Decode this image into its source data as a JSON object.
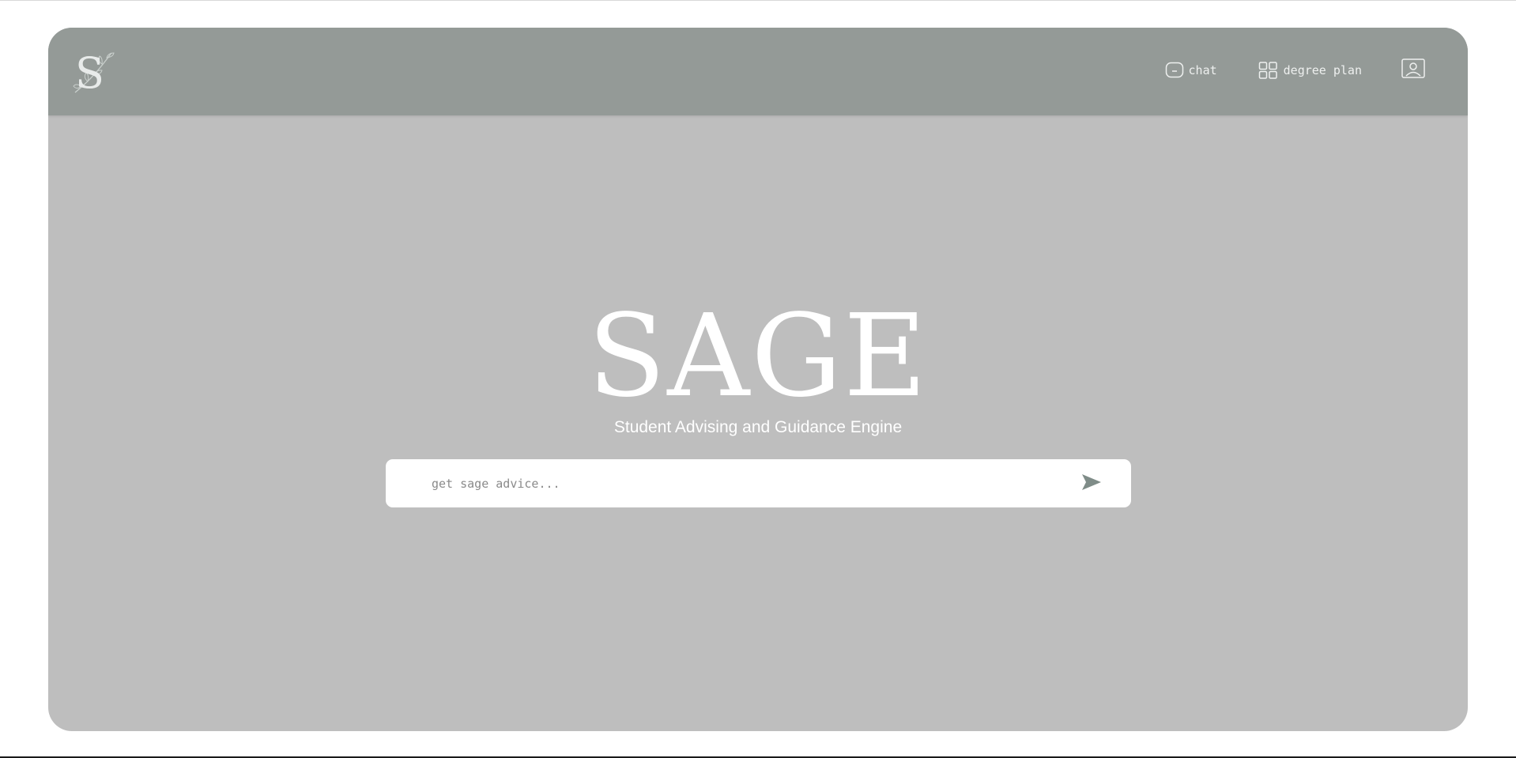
{
  "header": {
    "logo_letter": "S",
    "logo_icon": "sage-s-leaf-logo",
    "nav": {
      "chat": {
        "label": "chat",
        "icon": "chat-bubble-icon"
      },
      "degree_plan": {
        "label": "degree plan",
        "icon": "grid-icon"
      },
      "profile": {
        "icon": "profile-icon"
      }
    }
  },
  "hero": {
    "title": "SAGE",
    "subtitle": "Student Advising and Guidance Engine"
  },
  "search": {
    "placeholder": "get sage advice...",
    "value": "",
    "send_icon": "send-arrow-icon"
  },
  "colors": {
    "page_background": "#ffffff",
    "frame_background": "#bebebe",
    "header_background": "#949a97",
    "accent": "#7f8c88",
    "text_light": "#ffffff"
  }
}
